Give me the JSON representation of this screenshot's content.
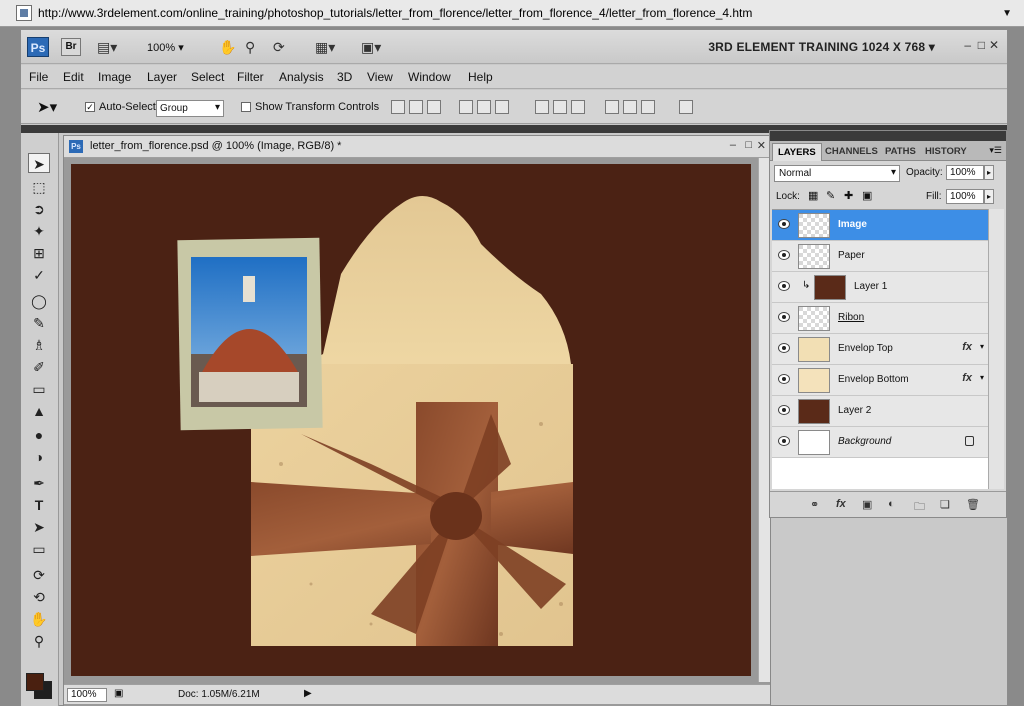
{
  "browser": {
    "url": "http://www.3rdelement.com/online_training/photoshop_tutorials/letter_from_florence/letter_from_florence_4/letter_from_florence_4.htm"
  },
  "app": {
    "ps_logo": "Ps",
    "br_logo": "Br",
    "zoom": "100% ▾",
    "workspace": "3RD ELEMENT TRAINING 1024 X 768 ▾"
  },
  "menu": [
    "File",
    "Edit",
    "Image",
    "Layer",
    "Select",
    "Filter",
    "Analysis",
    "3D",
    "View",
    "Window",
    "Help"
  ],
  "options": {
    "auto_select_label": "Auto-Select:",
    "auto_select_value": "Group",
    "show_transform_label": "Show Transform Controls"
  },
  "document": {
    "title": "letter_from_florence.psd @ 100% (Image, RGB/8) *",
    "status_zoom": "100%",
    "status_doc": "Doc: 1.05M/6.21M"
  },
  "layers_panel": {
    "tabs": [
      "LAYERS",
      "CHANNELS",
      "PATHS",
      "HISTORY"
    ],
    "blend_mode": "Normal",
    "opacity_label": "Opacity:",
    "opacity_value": "100%",
    "lock_label": "Lock:",
    "fill_label": "Fill:",
    "fill_value": "100%",
    "layers": [
      {
        "name": "Image",
        "selected": true
      },
      {
        "name": "Paper"
      },
      {
        "name": "Layer 1"
      },
      {
        "name": "Ribon"
      },
      {
        "name": "Envelop Top",
        "fx": "fx"
      },
      {
        "name": "Envelop Bottom",
        "fx": "fx"
      },
      {
        "name": "Layer 2"
      },
      {
        "name": "Background"
      }
    ]
  },
  "colors": {
    "canvas_bg": "#4b2214",
    "selection": "#3d8ee6",
    "foreground_swatch": "#4a2010"
  }
}
